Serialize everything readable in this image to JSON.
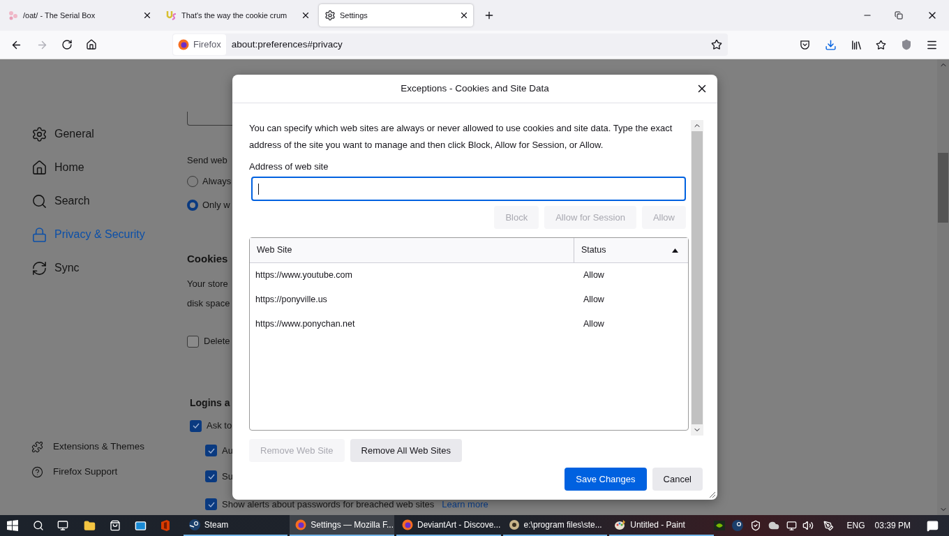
{
  "tabs": [
    {
      "title": "/oat/ - The Serial Box",
      "selected": false
    },
    {
      "title": "That's the way the cookie crum",
      "selected": false
    },
    {
      "title": "Settings",
      "selected": true
    }
  ],
  "toolbar": {
    "identity_label": "Firefox",
    "url": "about:preferences#privacy"
  },
  "sidebar": {
    "items": [
      {
        "label": "General",
        "selected": false
      },
      {
        "label": "Home",
        "selected": false
      },
      {
        "label": "Search",
        "selected": false
      },
      {
        "label": "Privacy & Security",
        "selected": true
      },
      {
        "label": "Sync",
        "selected": false
      }
    ],
    "footer_items": [
      {
        "label": "Extensions & Themes"
      },
      {
        "label": "Firefox Support"
      }
    ]
  },
  "page": {
    "send_web_label": "Send web",
    "radios": [
      {
        "label": "Always",
        "selected": false
      },
      {
        "label": "Only w",
        "selected": true
      }
    ],
    "cookies_heading": "Cookies",
    "cookies_text": [
      "Your store",
      "disk space"
    ],
    "delete_checkbox": {
      "label": "Delete",
      "checked": false
    },
    "logins_heading": "Logins a",
    "login_checkboxes": [
      {
        "label": "Ask to",
        "checked": true,
        "children": [
          {
            "label": "Au",
            "checked": true
          },
          {
            "label": "Su",
            "checked": true
          },
          {
            "label": "Show alerts about passwords for breached web sites",
            "checked": true,
            "link": "Learn more"
          }
        ]
      }
    ]
  },
  "dialog": {
    "title": "Exceptions - Cookies and Site Data",
    "description": "You can specify which web sites are always or never allowed to use cookies and site data. Type the exact address of the site you want to manage and then click Block, Allow for Session, or Allow.",
    "address_label": "Address of web site",
    "action_buttons": [
      {
        "label": "Block",
        "disabled": true
      },
      {
        "label": "Allow for Session",
        "disabled": true
      },
      {
        "label": "Allow",
        "disabled": true
      }
    ],
    "table": {
      "columns": [
        {
          "label": "Web Site",
          "sorted": false
        },
        {
          "label": "Status",
          "sorted": true,
          "ascending": true
        }
      ],
      "rows": [
        {
          "site": "https://www.youtube.com",
          "status": "Allow"
        },
        {
          "site": "https://ponyville.us",
          "status": "Allow"
        },
        {
          "site": "https://www.ponychan.net",
          "status": "Allow"
        }
      ]
    },
    "list_buttons": [
      {
        "label": "Remove Web Site",
        "disabled": true
      },
      {
        "label": "Remove All Web Sites",
        "disabled": false
      }
    ],
    "buttons": [
      {
        "label": "Save Changes",
        "primary": true
      },
      {
        "label": "Cancel",
        "primary": false
      }
    ]
  },
  "taskbar": {
    "items": [
      {
        "label": "Steam",
        "active": false
      },
      {
        "label": "Settings — Mozilla F...",
        "active": true
      },
      {
        "label": "DeviantArt - Discove...",
        "active": false
      },
      {
        "label": "e:\\program files\\ste...",
        "active": false
      },
      {
        "label": "Untitled - Paint",
        "active": false
      }
    ],
    "language": "ENG",
    "time": "03:39 PM"
  }
}
